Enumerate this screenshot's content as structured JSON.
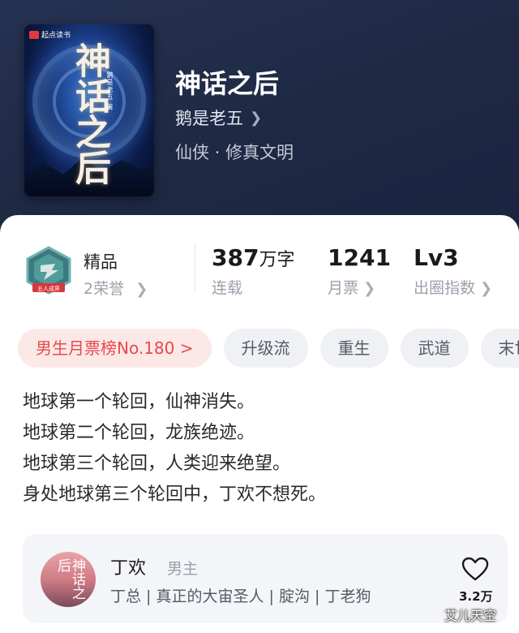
{
  "book": {
    "title": "神话之后",
    "author": "鹅是老五",
    "genre": "仙侠 · 修真文明",
    "cover": {
      "publisher": "起点读书",
      "title_art": "神话之后",
      "author_art": "鹅是老五·著"
    }
  },
  "stats": {
    "quality": "精品",
    "honors": "2荣誉",
    "word_count": "387",
    "word_unit": "万字",
    "status": "连载",
    "monthly_tickets_value": "1241",
    "monthly_tickets_label": "月票",
    "level_value": "Lv3",
    "level_label": "出圈指数"
  },
  "tags": [
    {
      "label": "男生月票榜No.180 >"
    },
    {
      "label": "升级流"
    },
    {
      "label": "重生"
    },
    {
      "label": "武道"
    },
    {
      "label": "末世"
    }
  ],
  "synopsis": [
    "地球第一个轮回，仙神消失。",
    "地球第二个轮回，龙族绝迹。",
    "地球第三个轮回，人类迎来绝望。",
    "身处地球第三个轮回中，丁欢不想死。"
  ],
  "character": {
    "avatar_text": "神话之后",
    "name": "丁欢",
    "role": "男主",
    "aliases": "丁总 | 真正的大宙圣人 | 腚沟 | 丁老狗",
    "likes": "3.2万"
  },
  "watermark": "艾儿天空",
  "colors": {
    "accent_red": "#e74a4a",
    "hero_bg": "#1f2a45"
  }
}
